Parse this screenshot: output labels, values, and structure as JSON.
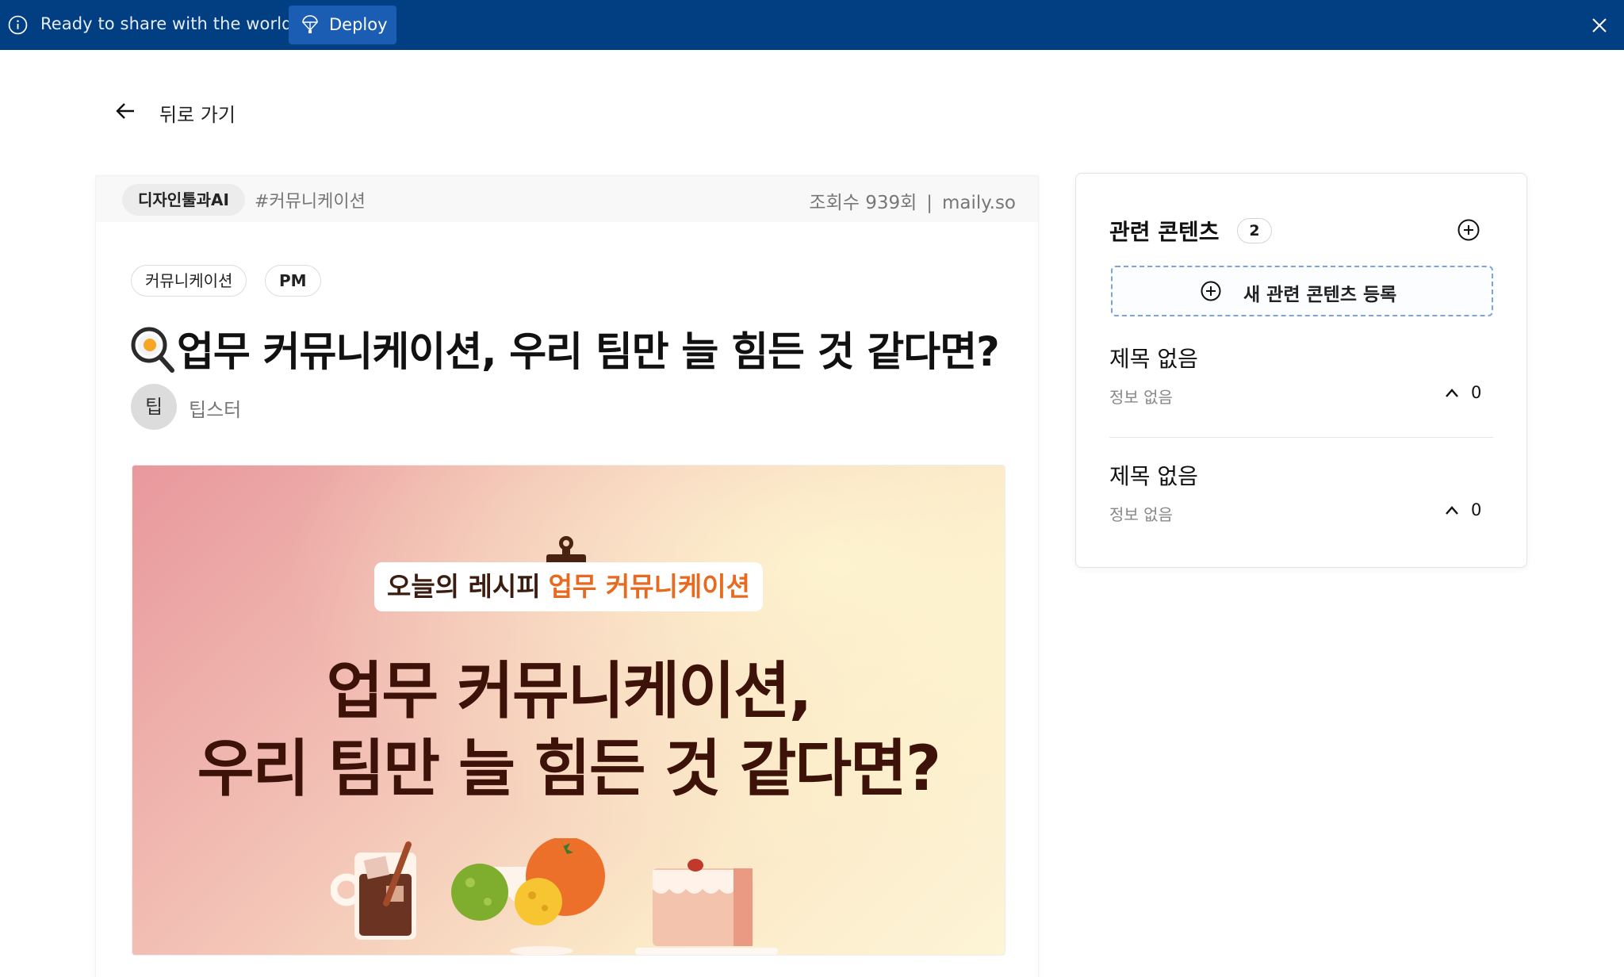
{
  "banner": {
    "text": "Ready to share with the world?",
    "deploy_label": "Deploy"
  },
  "nav": {
    "back_label": "뒤로 가기"
  },
  "article": {
    "category": "디자인툴과AI",
    "hashtag": "#커뮤니케이션",
    "views": "조회수 939회",
    "separator": "|",
    "source": "maily.so",
    "tags": [
      "커뮤니케이션",
      "PM"
    ],
    "title": "업무 커뮤니케이션, 우리 팀만 늘 힘든 것 같다면?",
    "author": {
      "avatar_text": "팁",
      "name": "팁스터"
    },
    "hero": {
      "recipe_lead": "오늘의 레시피",
      "recipe_highlight": "업무 커뮤니케이션",
      "line1": "업무 커뮤니케이션,",
      "line2": "우리 팀만 늘 힘든 것 같다면?"
    }
  },
  "related": {
    "title": "관련 콘텐츠",
    "count": "2",
    "new_button_label": "새 관련 콘텐츠 등록",
    "items": [
      {
        "title": "제목 없음",
        "info": "정보 없음",
        "votes": "0"
      },
      {
        "title": "제목 없음",
        "info": "정보 없음",
        "votes": "0"
      }
    ]
  },
  "colors": {
    "banner_bg": "#023e82",
    "deploy_bg": "#1a5db3",
    "highlight": "#e66a1f",
    "hero_text": "#3d1208",
    "dashed_border": "#7aa3e0"
  }
}
